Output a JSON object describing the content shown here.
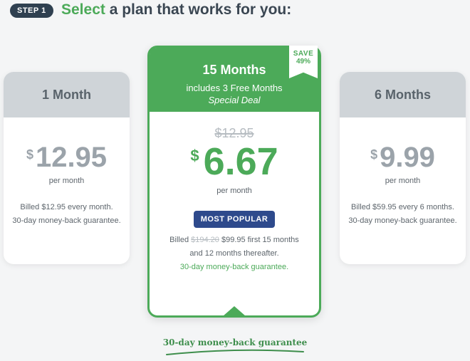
{
  "header": {
    "step_label": "STEP 1",
    "headline_accent": "Select",
    "headline_rest": " a plan that works for you:"
  },
  "plans": [
    {
      "title": "1 Month",
      "currency": "$",
      "price": "12.95",
      "per": "per month",
      "billed_line1": "Billed $12.95 every month.",
      "billed_line2": "30-day money-back guarantee."
    },
    {
      "title": "15 Months",
      "subtitle": "includes 3 Free Months",
      "deal": "Special Deal",
      "save_label": "SAVE",
      "save_pct": "49%",
      "old_price": "$12.95",
      "currency": "$",
      "price": "6.67",
      "per": "per month",
      "badge": "MOST POPULAR",
      "billed_prefix": "Billed ",
      "billed_strike": "$194.20",
      "billed_rest": " $99.95 first 15 months",
      "billed_line2": "and 12 months thereafter.",
      "guarantee": "30-day money-back guarantee."
    },
    {
      "title": "6 Months",
      "currency": "$",
      "price": "9.99",
      "per": "per month",
      "billed_line1": "Billed $59.95 every 6 months.",
      "billed_line2": "30-day money-back guarantee."
    }
  ],
  "footer": {
    "guarantee": "30-day money-back guarantee"
  },
  "colors": {
    "accent_green": "#4caa59",
    "badge_navy": "#2e4a8c",
    "step_badge": "#2f4050",
    "side_header": "#cfd4d8"
  }
}
